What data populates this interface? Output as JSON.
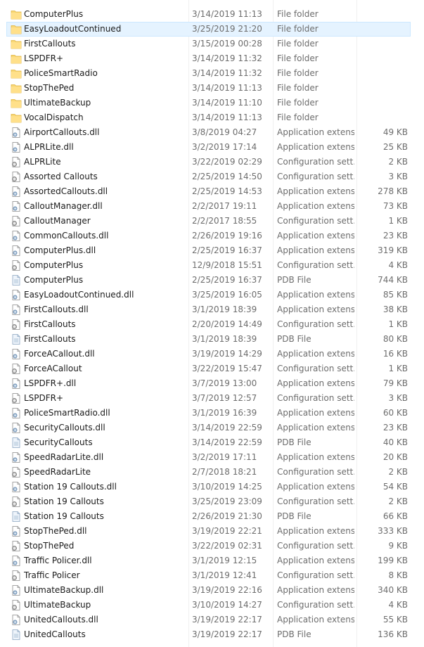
{
  "colors": {
    "selected_bg": "#e5f3ff",
    "folder": "#f8d775",
    "secondary_text": "#6d6d6d"
  },
  "files": [
    {
      "name": "ComputerPlus",
      "date": "3/14/2019 11:13",
      "type": "File folder",
      "size": "",
      "icon": "folder-icon"
    },
    {
      "name": "EasyLoadoutContinued",
      "date": "3/25/2019 21:20",
      "type": "File folder",
      "size": "",
      "icon": "folder-icon",
      "selected": true
    },
    {
      "name": "FirstCallouts",
      "date": "3/15/2019 00:28",
      "type": "File folder",
      "size": "",
      "icon": "folder-icon"
    },
    {
      "name": "LSPDFR+",
      "date": "3/14/2019 11:32",
      "type": "File folder",
      "size": "",
      "icon": "folder-icon"
    },
    {
      "name": "PoliceSmartRadio",
      "date": "3/14/2019 11:32",
      "type": "File folder",
      "size": "",
      "icon": "folder-icon"
    },
    {
      "name": "StopThePed",
      "date": "3/14/2019 11:13",
      "type": "File folder",
      "size": "",
      "icon": "folder-icon"
    },
    {
      "name": "UltimateBackup",
      "date": "3/14/2019 11:10",
      "type": "File folder",
      "size": "",
      "icon": "folder-icon"
    },
    {
      "name": "VocalDispatch",
      "date": "3/14/2019 11:13",
      "type": "File folder",
      "size": "",
      "icon": "folder-icon"
    },
    {
      "name": "AirportCallouts.dll",
      "date": "3/8/2019 04:27",
      "type": "Application extens...",
      "size": "49 KB",
      "icon": "dll-icon"
    },
    {
      "name": "ALPRLite.dll",
      "date": "3/2/2019 17:14",
      "type": "Application extens...",
      "size": "25 KB",
      "icon": "dll-icon"
    },
    {
      "name": "ALPRLite",
      "date": "3/22/2019 02:29",
      "type": "Configuration sett...",
      "size": "2 KB",
      "icon": "config-icon"
    },
    {
      "name": "Assorted Callouts",
      "date": "2/25/2019 14:50",
      "type": "Configuration sett...",
      "size": "3 KB",
      "icon": "config-icon"
    },
    {
      "name": "AssortedCallouts.dll",
      "date": "2/25/2019 14:53",
      "type": "Application extens...",
      "size": "278 KB",
      "icon": "dll-icon"
    },
    {
      "name": "CalloutManager.dll",
      "date": "2/2/2017 19:11",
      "type": "Application extens...",
      "size": "73 KB",
      "icon": "dll-icon"
    },
    {
      "name": "CalloutManager",
      "date": "2/2/2017 18:55",
      "type": "Configuration sett...",
      "size": "1 KB",
      "icon": "config-icon"
    },
    {
      "name": "CommonCallouts.dll",
      "date": "2/26/2019 19:16",
      "type": "Application extens...",
      "size": "23 KB",
      "icon": "dll-icon"
    },
    {
      "name": "ComputerPlus.dll",
      "date": "2/25/2019 16:37",
      "type": "Application extens...",
      "size": "319 KB",
      "icon": "dll-icon"
    },
    {
      "name": "ComputerPlus",
      "date": "12/9/2018 15:51",
      "type": "Configuration sett...",
      "size": "4 KB",
      "icon": "config-icon"
    },
    {
      "name": "ComputerPlus",
      "date": "2/25/2019 16:37",
      "type": "PDB File",
      "size": "744 KB",
      "icon": "pdb-icon"
    },
    {
      "name": "EasyLoadoutContinued.dll",
      "date": "3/25/2019 16:05",
      "type": "Application extens...",
      "size": "85 KB",
      "icon": "dll-icon"
    },
    {
      "name": "FirstCallouts.dll",
      "date": "3/1/2019 18:39",
      "type": "Application extens...",
      "size": "38 KB",
      "icon": "dll-icon"
    },
    {
      "name": "FirstCallouts",
      "date": "2/20/2019 14:49",
      "type": "Configuration sett...",
      "size": "1 KB",
      "icon": "config-icon"
    },
    {
      "name": "FirstCallouts",
      "date": "3/1/2019 18:39",
      "type": "PDB File",
      "size": "80 KB",
      "icon": "pdb-icon"
    },
    {
      "name": "ForceACallout.dll",
      "date": "3/19/2019 14:29",
      "type": "Application extens...",
      "size": "16 KB",
      "icon": "dll-icon"
    },
    {
      "name": "ForceACallout",
      "date": "3/22/2019 15:47",
      "type": "Configuration sett...",
      "size": "1 KB",
      "icon": "config-icon"
    },
    {
      "name": "LSPDFR+.dll",
      "date": "3/7/2019 13:00",
      "type": "Application extens...",
      "size": "79 KB",
      "icon": "dll-icon"
    },
    {
      "name": "LSPDFR+",
      "date": "3/7/2019 12:57",
      "type": "Configuration sett...",
      "size": "3 KB",
      "icon": "config-icon"
    },
    {
      "name": "PoliceSmartRadio.dll",
      "date": "3/1/2019 16:39",
      "type": "Application extens...",
      "size": "60 KB",
      "icon": "dll-icon"
    },
    {
      "name": "SecurityCallouts.dll",
      "date": "3/14/2019 22:59",
      "type": "Application extens...",
      "size": "23 KB",
      "icon": "dll-icon"
    },
    {
      "name": "SecurityCallouts",
      "date": "3/14/2019 22:59",
      "type": "PDB File",
      "size": "40 KB",
      "icon": "pdb-icon"
    },
    {
      "name": "SpeedRadarLite.dll",
      "date": "3/2/2019 17:11",
      "type": "Application extens...",
      "size": "20 KB",
      "icon": "dll-icon"
    },
    {
      "name": "SpeedRadarLite",
      "date": "2/7/2018 18:21",
      "type": "Configuration sett...",
      "size": "2 KB",
      "icon": "config-icon"
    },
    {
      "name": "Station 19 Callouts.dll",
      "date": "3/10/2019 14:25",
      "type": "Application extens...",
      "size": "54 KB",
      "icon": "dll-icon"
    },
    {
      "name": "Station 19 Callouts",
      "date": "3/25/2019 23:09",
      "type": "Configuration sett...",
      "size": "2 KB",
      "icon": "config-icon"
    },
    {
      "name": "Station 19 Callouts",
      "date": "2/26/2019 21:30",
      "type": "PDB File",
      "size": "66 KB",
      "icon": "pdb-icon"
    },
    {
      "name": "StopThePed.dll",
      "date": "3/19/2019 22:21",
      "type": "Application extens...",
      "size": "333 KB",
      "icon": "dll-icon"
    },
    {
      "name": "StopThePed",
      "date": "3/22/2019 02:31",
      "type": "Configuration sett...",
      "size": "9 KB",
      "icon": "config-icon"
    },
    {
      "name": "Traffic Policer.dll",
      "date": "3/1/2019 12:15",
      "type": "Application extens...",
      "size": "199 KB",
      "icon": "dll-icon"
    },
    {
      "name": "Traffic Policer",
      "date": "3/1/2019 12:41",
      "type": "Configuration sett...",
      "size": "8 KB",
      "icon": "config-icon"
    },
    {
      "name": "UltimateBackup.dll",
      "date": "3/19/2019 22:16",
      "type": "Application extens...",
      "size": "340 KB",
      "icon": "dll-icon"
    },
    {
      "name": "UltimateBackup",
      "date": "3/10/2019 14:27",
      "type": "Configuration sett...",
      "size": "4 KB",
      "icon": "config-icon"
    },
    {
      "name": "UnitedCallouts.dll",
      "date": "3/19/2019 22:17",
      "type": "Application extens...",
      "size": "55 KB",
      "icon": "dll-icon"
    },
    {
      "name": "UnitedCallouts",
      "date": "3/19/2019 22:17",
      "type": "PDB File",
      "size": "136 KB",
      "icon": "pdb-icon"
    }
  ]
}
